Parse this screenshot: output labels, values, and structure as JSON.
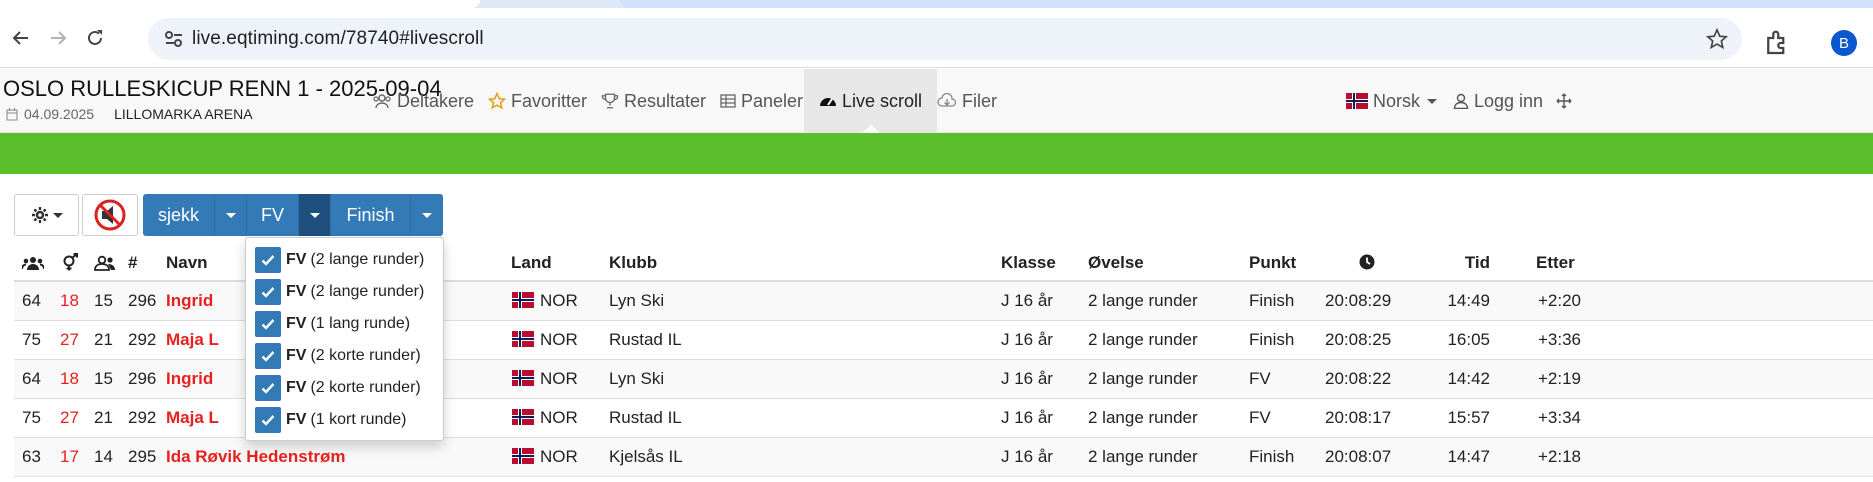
{
  "browser": {
    "url": "live.eqtiming.com/78740#livescroll",
    "profile_initial": "B"
  },
  "event": {
    "title": "OSLO RULLESKICUP RENN 1 - 2025-09-04",
    "date": "04.09.2025",
    "venue": "LILLOMARKA ARENA"
  },
  "nav": {
    "items": [
      {
        "label": "Deltakere",
        "icon": "users-icon"
      },
      {
        "label": "Favoritter",
        "icon": "star-icon"
      },
      {
        "label": "Resultater",
        "icon": "trophy-icon"
      },
      {
        "label": "Paneler",
        "icon": "table-icon"
      },
      {
        "label": "Live scroll",
        "icon": "dashboard-icon"
      },
      {
        "label": "Filer",
        "icon": "download-icon"
      }
    ],
    "active": "Live scroll",
    "language": "Norsk",
    "login": "Logg inn"
  },
  "controls": {
    "filter_sjekk": "sjekk",
    "filter_fv": "FV",
    "filter_finish": "Finish"
  },
  "dropdown": {
    "items": [
      {
        "code": "FV",
        "label": "(2 lange runder)",
        "checked": true
      },
      {
        "code": "FV",
        "label": "(2 lange runder)",
        "checked": true
      },
      {
        "code": "FV",
        "label": "(1 lang runde)",
        "checked": true
      },
      {
        "code": "FV",
        "label": "(2 korte runder)",
        "checked": true
      },
      {
        "code": "FV",
        "label": "(2 korte runder)",
        "checked": true
      },
      {
        "code": "FV",
        "label": "(1 kort runde)",
        "checked": true
      }
    ]
  },
  "table": {
    "headers": {
      "hash": "#",
      "name": "Navn",
      "country": "Land",
      "club": "Klubb",
      "class": "Klasse",
      "event": "Øvelse",
      "point": "Punkt",
      "time": "Tid",
      "behind": "Etter"
    },
    "rows": [
      {
        "c1": "64",
        "c2": "18",
        "c3": "15",
        "bib": "296",
        "name": "Ingrid",
        "country": "NOR",
        "club": "Lyn Ski",
        "class": "J 16 år",
        "event": "2 lange runder",
        "point": "Finish",
        "clock": "20:08:29",
        "time": "14:49",
        "behind": "+2:20"
      },
      {
        "c1": "75",
        "c2": "27",
        "c3": "21",
        "bib": "292",
        "name": "Maja L",
        "country": "NOR",
        "club": "Rustad IL",
        "class": "J 16 år",
        "event": "2 lange runder",
        "point": "Finish",
        "clock": "20:08:25",
        "time": "16:05",
        "behind": "+3:36"
      },
      {
        "c1": "64",
        "c2": "18",
        "c3": "15",
        "bib": "296",
        "name": "Ingrid",
        "country": "NOR",
        "club": "Lyn Ski",
        "class": "J 16 år",
        "event": "2 lange runder",
        "point": "FV",
        "clock": "20:08:22",
        "time": "14:42",
        "behind": "+2:19"
      },
      {
        "c1": "75",
        "c2": "27",
        "c3": "21",
        "bib": "292",
        "name": "Maja L",
        "country": "NOR",
        "club": "Rustad IL",
        "class": "J 16 år",
        "event": "2 lange runder",
        "point": "FV",
        "clock": "20:08:17",
        "time": "15:57",
        "behind": "+3:34"
      },
      {
        "c1": "63",
        "c2": "17",
        "c3": "14",
        "bib": "295",
        "name": "Ida Røvik Hedenstrøm",
        "country": "NOR",
        "club": "Kjelsås IL",
        "class": "J 16 år",
        "event": "2 lange runder",
        "point": "Finish",
        "clock": "20:08:07",
        "time": "14:47",
        "behind": "+2:18"
      }
    ]
  },
  "colors": {
    "primary": "#337ab7",
    "green_bar": "#5abf2a",
    "name_red": "#e8201f"
  }
}
